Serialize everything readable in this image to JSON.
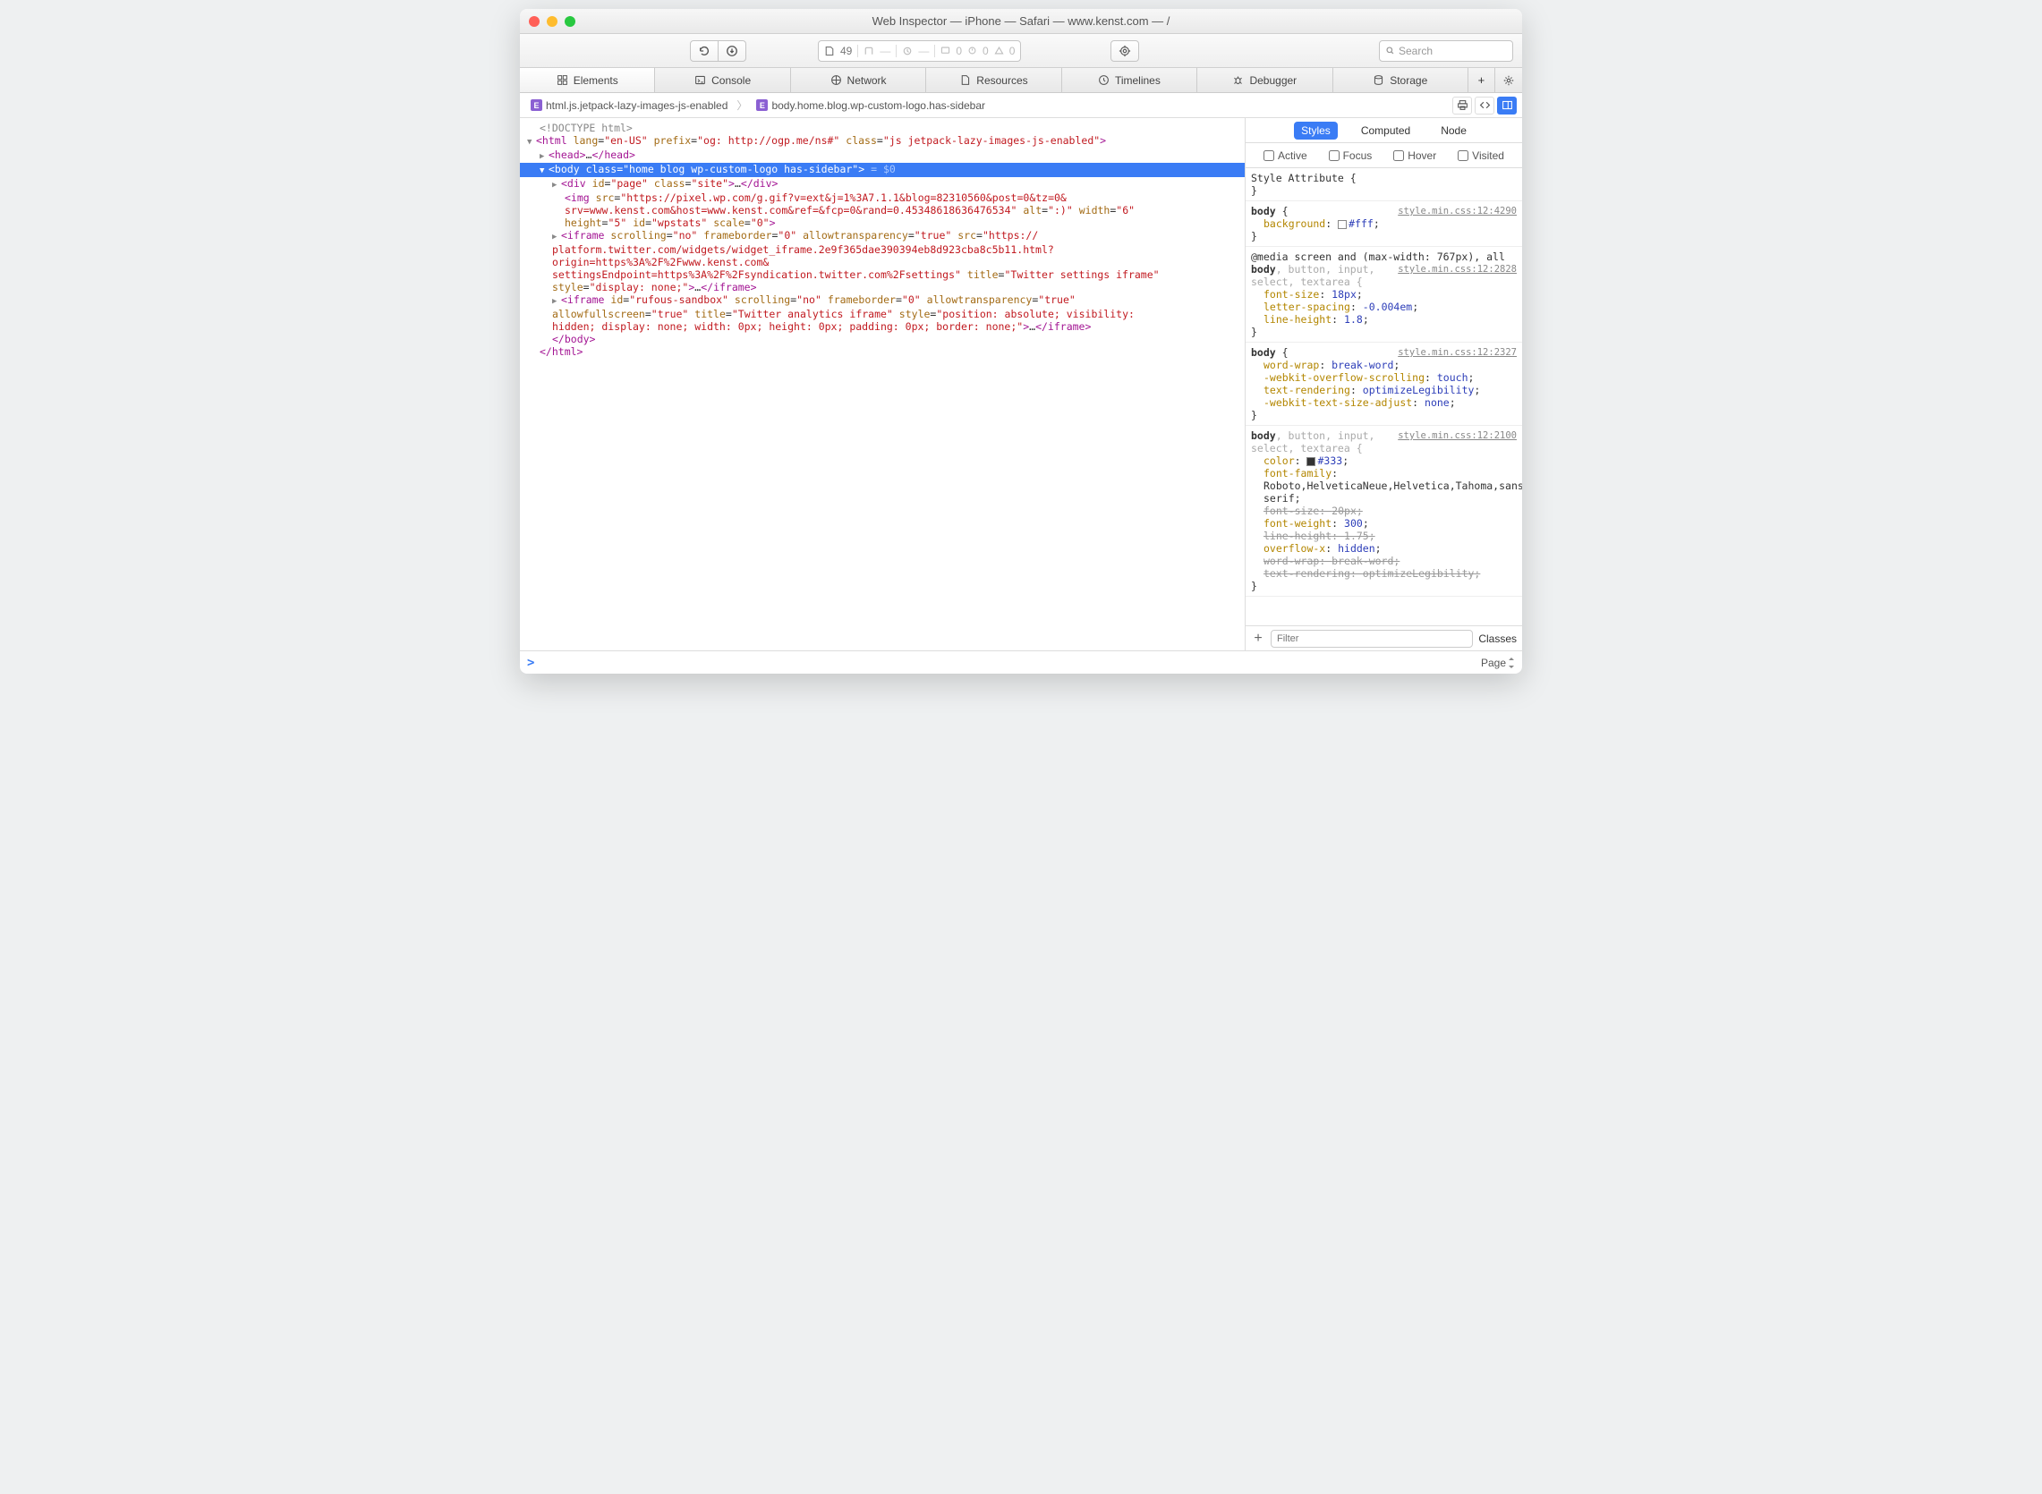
{
  "window": {
    "title": "Web Inspector — iPhone — Safari — www.kenst.com — /"
  },
  "toolbar": {
    "resource_count": "49",
    "log0a": "0",
    "log0b": "0",
    "log0c": "0",
    "search_placeholder": "Search"
  },
  "tabs": {
    "elements": "Elements",
    "console": "Console",
    "network": "Network",
    "resources": "Resources",
    "timelines": "Timelines",
    "debugger": "Debugger",
    "storage": "Storage"
  },
  "breadcrumb": {
    "item1": "html.js.jetpack-lazy-images-js-enabled",
    "item2": "body.home.blog.wp-custom-logo.has-sidebar"
  },
  "dom": {
    "doctype": "<!DOCTYPE html>",
    "html_open": "<html lang=\"en-US\" prefix=\"og: http://ogp.me/ns#\" class=\"js jetpack-lazy-images-js-enabled\">",
    "head": "<head>…</head>",
    "body_open": "<body class=\"home blog wp-custom-logo has-sidebar\">",
    "body_suffix": " = $0",
    "div": "<div id=\"page\" class=\"site\">…</div>",
    "img": "<img src=\"https://pixel.wp.com/g.gif?v=ext&j=1%3A7.1.1&blog=82310560&post=0&tz=0&srv=www.kenst.com&host=www.kenst.com&ref=&fcp=0&rand=0.45348618636476534\" alt=\":)\" width=\"6\" height=\"5\" id=\"wpstats\" scale=\"0\">",
    "iframe1": "<iframe scrolling=\"no\" frameborder=\"0\" allowtransparency=\"true\" src=\"https://platform.twitter.com/widgets/widget_iframe.2e9f365dae390394eb8d923cba8c5b11.html?origin=https%3A%2F%2Fwww.kenst.com&settingsEndpoint=https%3A%2F%2Fsyndication.twitter.com%2Fsettings\" title=\"Twitter settings iframe\" style=\"display: none;\">…</iframe>",
    "iframe2": "<iframe id=\"rufous-sandbox\" scrolling=\"no\" frameborder=\"0\" allowtransparency=\"true\" allowfullscreen=\"true\" title=\"Twitter analytics iframe\" style=\"position: absolute; visibility: hidden; display: none; width: 0px; height: 0px; padding: 0px; border: none;\">…</iframe>",
    "body_close": "</body>",
    "html_close": "</html>"
  },
  "style_tabs": {
    "styles": "Styles",
    "computed": "Computed",
    "node": "Node"
  },
  "forces": {
    "active": "Active",
    "focus": "Focus",
    "hover": "Hover",
    "visited": "Visited"
  },
  "rules": {
    "r1": {
      "head": "Style Attribute {",
      "close": "}"
    },
    "r2": {
      "sel": "body {",
      "src": "style.min.css:12:4290",
      "p1n": "background",
      "p1v": "#fff",
      "close": "}"
    },
    "r3": {
      "media": "@media screen and (max-width: 767px), all",
      "sel_main": "body",
      "sel_rest": ", button, input, select, textarea {",
      "src": "style.min.css:12:2828",
      "p1n": "font-size",
      "p1v": "18px",
      "p2n": "letter-spacing",
      "p2v": "-0.004em",
      "p3n": "line-height",
      "p3v": "1.8",
      "close": "}"
    },
    "r4": {
      "sel": "body {",
      "src": "style.min.css:12:2327",
      "p1n": "word-wrap",
      "p1v": "break-word",
      "p2n": "-webkit-overflow-scrolling",
      "p2v": "touch",
      "p3n": "text-rendering",
      "p3v": "optimizeLegibility",
      "p4n": "-webkit-text-size-adjust",
      "p4v": "none",
      "close": "}"
    },
    "r5": {
      "sel_main": "body",
      "sel_rest": ", button, input, select, textarea {",
      "src": "style.min.css:12:2100",
      "p1n": "color",
      "p1v": "#333",
      "p2n": "font-family",
      "p2v": "Roboto,HelveticaNeue,Helvetica,Tahoma,sans-serif",
      "p3n": "font-size",
      "p3v": "20px",
      "p4n": "font-weight",
      "p4v": "300",
      "p5n": "line-height",
      "p5v": "1.75",
      "p6n": "overflow-x",
      "p6v": "hidden",
      "p7n": "word-wrap",
      "p7v": "break-word",
      "p8n": "text-rendering",
      "p8v": "optimizeLegibility",
      "close": "}"
    }
  },
  "filter": {
    "placeholder": "Filter",
    "classes": "Classes"
  },
  "footer": {
    "scope": "Page"
  }
}
